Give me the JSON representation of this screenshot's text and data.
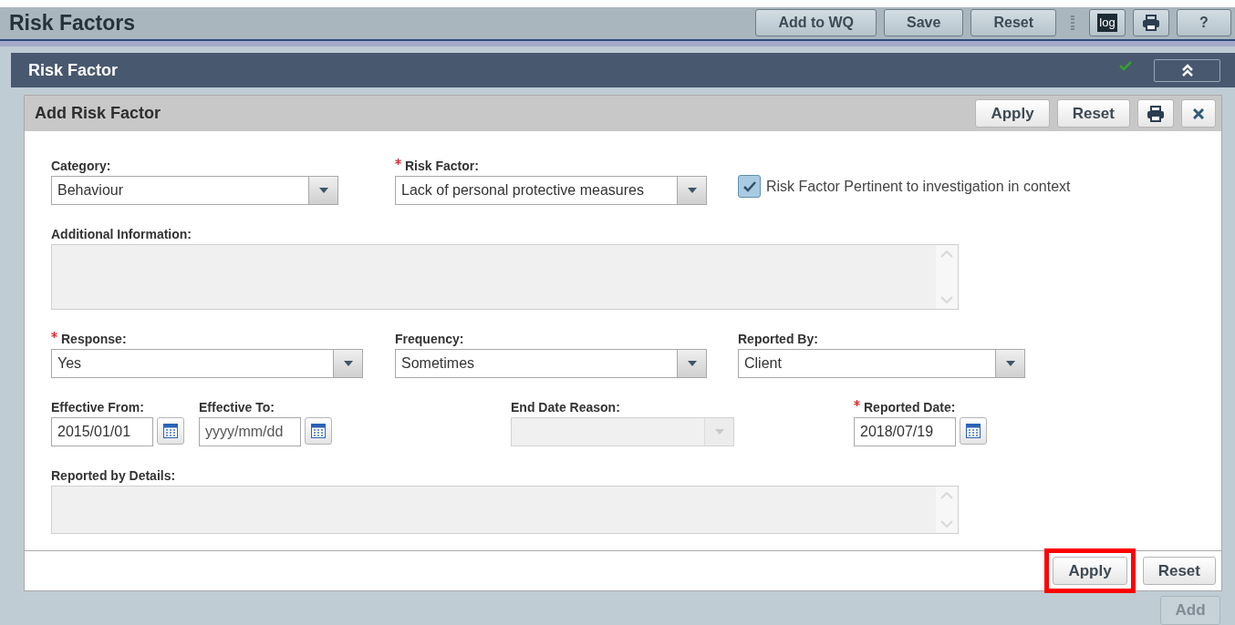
{
  "page": {
    "title": "Risk Factors"
  },
  "toolbar": [
    {
      "kind": "text",
      "label": "Add to WQ"
    },
    {
      "kind": "text",
      "label": "Save"
    },
    {
      "kind": "text",
      "label": "Reset"
    },
    {
      "kind": "grip"
    },
    {
      "kind": "log",
      "label": "log"
    },
    {
      "kind": "print"
    },
    {
      "kind": "text",
      "label": "?"
    }
  ],
  "panel": {
    "title": "Risk Factor",
    "validated": true,
    "expanded": true
  },
  "subpanel": {
    "title": "Add Risk Factor",
    "actions": [
      {
        "kind": "text",
        "label": "Apply"
      },
      {
        "kind": "text",
        "label": "Reset"
      },
      {
        "kind": "print"
      },
      {
        "kind": "close"
      }
    ]
  },
  "form": {
    "rows": [
      {
        "fields": [
          {
            "kind": "select",
            "label": "Category:",
            "required": false,
            "value": "Behaviour",
            "disabled": false
          },
          {
            "kind": "select",
            "label": "Risk Factor:",
            "required": true,
            "value": "Lack of personal protective measures",
            "disabled": false
          },
          {
            "kind": "checkbox",
            "label": "Risk Factor Pertinent to investigation in context",
            "checked": true
          }
        ]
      },
      {
        "fields": [
          {
            "kind": "textarea",
            "label": "Additional Information:",
            "required": false
          }
        ]
      },
      {
        "fields": [
          {
            "kind": "select",
            "label": "Response:",
            "required": true,
            "value": "Yes",
            "disabled": false
          },
          {
            "kind": "select",
            "label": "Frequency:",
            "required": false,
            "value": "Sometimes",
            "disabled": false
          },
          {
            "kind": "select",
            "label": "Reported By:",
            "required": false,
            "value": "Client",
            "disabled": false
          }
        ]
      },
      {
        "fields": [
          {
            "kind": "date",
            "label": "Effective From:",
            "required": false,
            "value": "2015/01/01"
          },
          {
            "kind": "date",
            "label": "Effective To:",
            "required": false,
            "placeholder": "yyyy/mm/dd"
          },
          {
            "kind": "select",
            "label": "End Date Reason:",
            "required": false,
            "disabled": true
          },
          {
            "kind": "date",
            "label": "Reported Date:",
            "required": true,
            "value": "2018/07/19"
          }
        ]
      },
      {
        "fields": [
          {
            "kind": "textarea",
            "label": "Reported by Details:",
            "required": false
          }
        ]
      }
    ]
  },
  "footer": {
    "actions": [
      {
        "label": "Apply",
        "highlighted": true
      },
      {
        "label": "Reset",
        "highlighted": false
      }
    ]
  },
  "bottom": {
    "actions": [
      {
        "label": "Add",
        "disabled": true
      }
    ]
  }
}
